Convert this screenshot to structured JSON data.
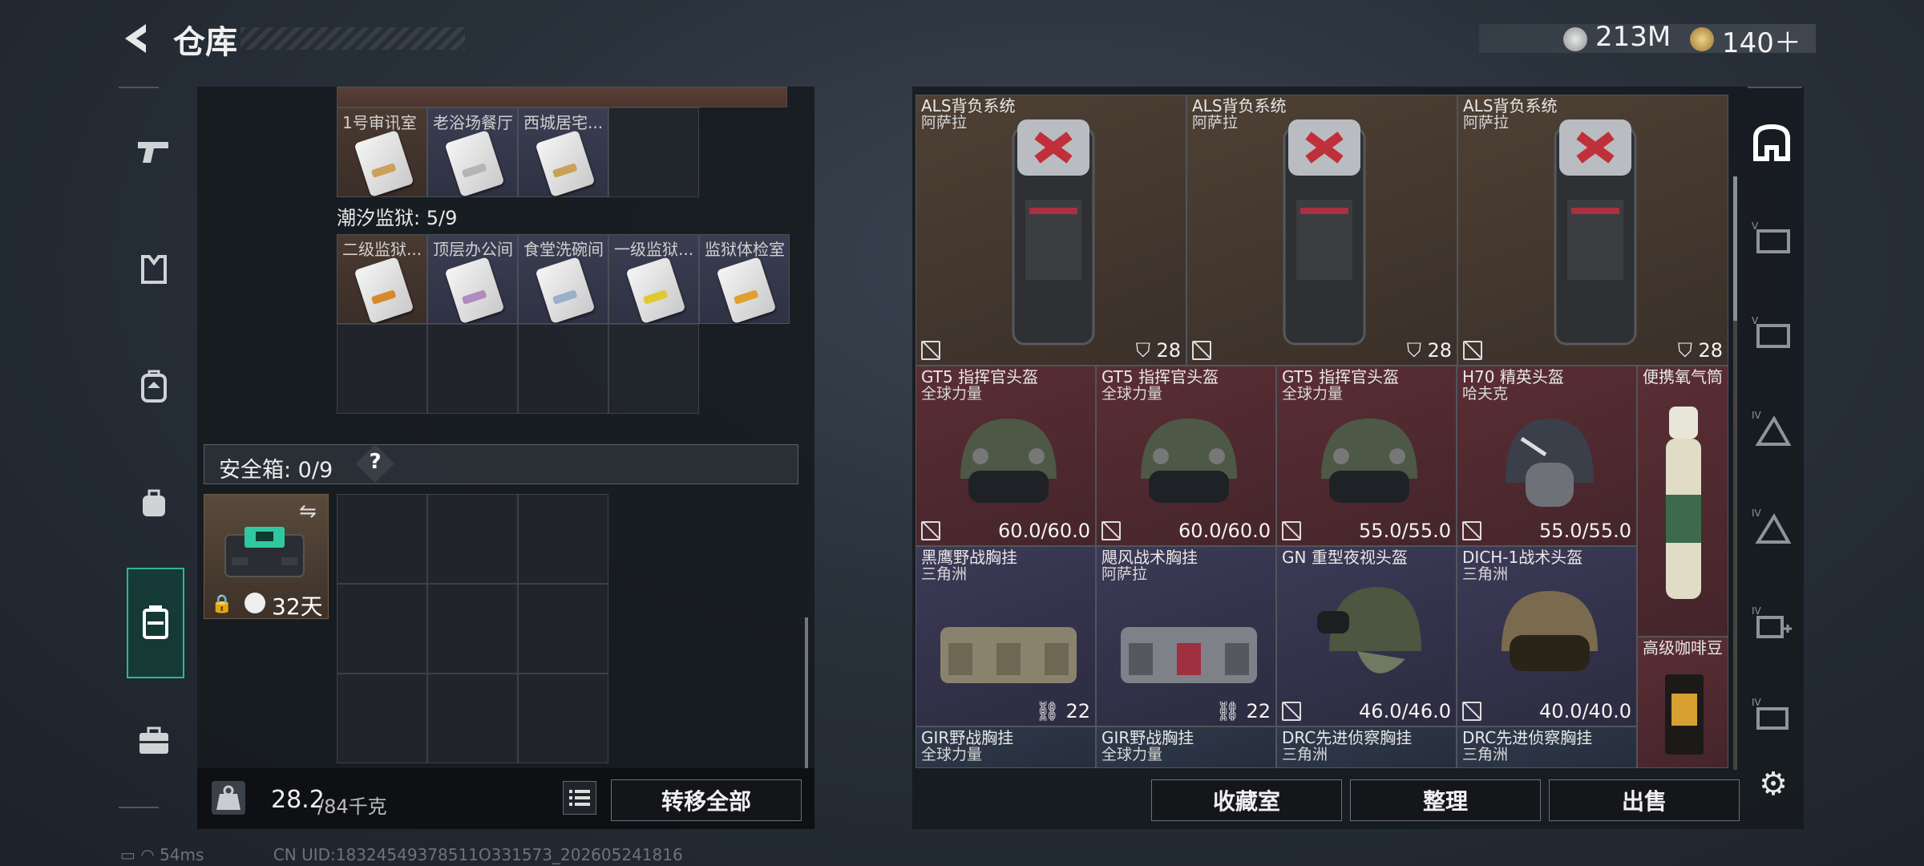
{
  "header": {
    "title": "仓库",
    "currency": [
      {
        "icon": "silver-coin-icon",
        "value": "213M",
        "color": "#b9bcc0"
      },
      {
        "icon": "gold-coin-icon",
        "value": "140＋",
        "color": "#c8a04a"
      }
    ]
  },
  "left_nav": {
    "items": [
      {
        "icon": "pistol-icon"
      },
      {
        "icon": "vest-icon"
      },
      {
        "icon": "backpack-icon"
      },
      {
        "icon": "small-backpack-icon"
      },
      {
        "icon": "container-icon",
        "active": true
      },
      {
        "icon": "briefcase-icon"
      }
    ]
  },
  "keys": {
    "top_row": [
      "1号审讯室",
      "老浴场餐厅",
      "西城居宅..."
    ],
    "prison_label": "潮汐监狱: 5/9",
    "prison_row": [
      "二级监狱...",
      "顶层办公间",
      "食堂洗碗间",
      "一级监狱...",
      "监狱体检室"
    ]
  },
  "safe_box": {
    "label": "安全箱: 0/9",
    "help": "?",
    "days": "32天"
  },
  "weight": {
    "current": "28.2",
    "max": "/84千克",
    "transfer_all": "转移全部"
  },
  "storage_items": {
    "backpacks": [
      {
        "name": "ALS背负系统",
        "sub": "阿萨拉",
        "cap": "28"
      },
      {
        "name": "ALS背负系统",
        "sub": "阿萨拉",
        "cap": "28"
      },
      {
        "name": "ALS背负系统",
        "sub": "阿萨拉",
        "cap": "28"
      }
    ],
    "helmets_row": [
      {
        "name": "GT5 指挥官头盔",
        "sub": "全球力量",
        "dur": "60.0/60.0"
      },
      {
        "name": "GT5 指挥官头盔",
        "sub": "全球力量",
        "dur": "60.0/60.0"
      },
      {
        "name": "GT5 指挥官头盔",
        "sub": "全球力量",
        "dur": "55.0/55.0"
      },
      {
        "name": "H70 精英头盔",
        "sub": "哈夫克",
        "dur": "55.0/55.0"
      }
    ],
    "oxygen": {
      "name": "便携氧气筒"
    },
    "row3": [
      {
        "name": "黑鹰野战胸挂",
        "sub": "三角洲",
        "cap": "22"
      },
      {
        "name": "飓风战术胸挂",
        "sub": "阿萨拉",
        "cap": "22"
      },
      {
        "name": "GN 重型夜视头盔",
        "sub": "",
        "dur": "46.0/46.0"
      },
      {
        "name": "DICH-1战术头盔",
        "sub": "三角洲",
        "dur": "40.0/40.0"
      }
    ],
    "coffee": {
      "name": "高级咖啡豆"
    },
    "row4": [
      {
        "name": "GIR野战胸挂",
        "sub": "全球力量"
      },
      {
        "name": "GIR野战胸挂",
        "sub": "全球力量"
      },
      {
        "name": "DRC先进侦察胸挂",
        "sub": "三角洲"
      },
      {
        "name": "DRC先进侦察胸挂",
        "sub": "三角洲"
      }
    ]
  },
  "bottom_buttons": {
    "collection": "收藏室",
    "organize": "整理",
    "sell": "出售"
  },
  "right_nav": [
    "IV",
    "IV",
    "IV",
    "IV",
    "IV"
  ],
  "status": {
    "ping": "54ms",
    "uid": "CN UID:18324549378511O331573_202605241816"
  }
}
